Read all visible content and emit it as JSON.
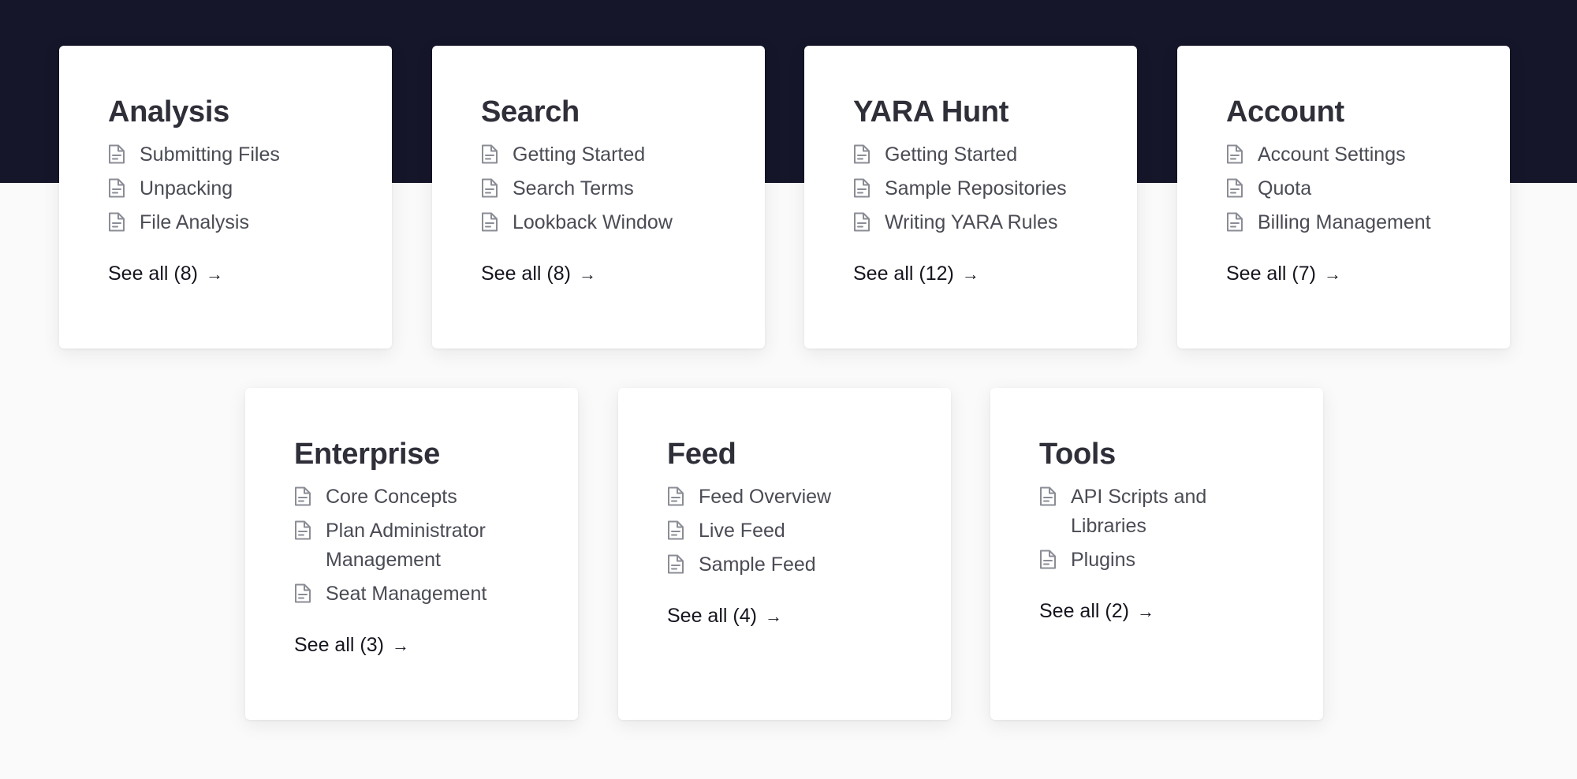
{
  "cards": [
    {
      "title": "Analysis",
      "items": [
        "Submitting Files",
        "Unpacking",
        "File Analysis"
      ],
      "see_all": "See all (8)"
    },
    {
      "title": "Search",
      "items": [
        "Getting Started",
        "Search Terms",
        "Lookback Window"
      ],
      "see_all": "See all (8)"
    },
    {
      "title": "YARA Hunt",
      "items": [
        "Getting Started",
        "Sample Repositories",
        "Writing YARA Rules"
      ],
      "see_all": "See all (12)"
    },
    {
      "title": "Account",
      "items": [
        "Account Settings",
        "Quota",
        "Billing Management"
      ],
      "see_all": "See all (7)"
    },
    {
      "title": "Enterprise",
      "items": [
        "Core Concepts",
        "Plan Administrator Management",
        "Seat Management"
      ],
      "see_all": "See all (3)"
    },
    {
      "title": "Feed",
      "items": [
        "Feed Overview",
        "Live Feed",
        "Sample Feed"
      ],
      "see_all": "See all (4)"
    },
    {
      "title": "Tools",
      "items": [
        "API Scripts and Libraries",
        "Plugins"
      ],
      "see_all": "See all (2)"
    }
  ],
  "icons": {
    "item_icon": "document-icon",
    "see_all_icon": "arrow-right-icon"
  },
  "colors": {
    "hero_background": "#16162a",
    "page_background": "#fafafa",
    "card_background": "#ffffff",
    "title_text": "#2e2f38",
    "item_text": "#4a4c55",
    "icon_stroke": "#8a8c96"
  }
}
